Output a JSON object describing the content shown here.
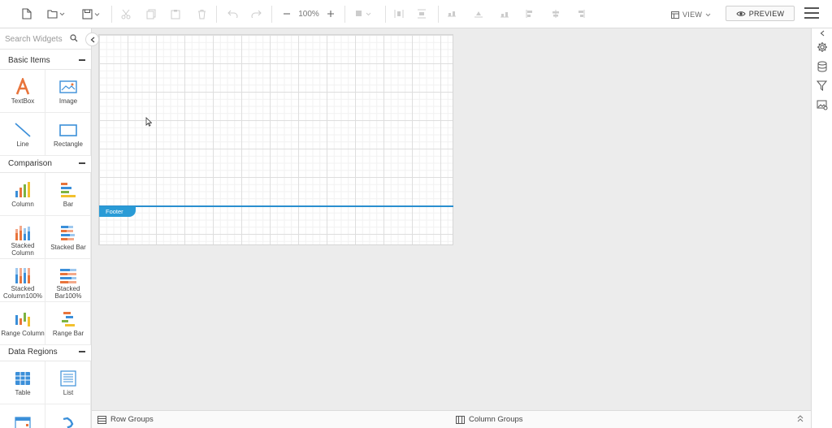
{
  "toolbar": {
    "zoom_level": "100%",
    "view_label": "VIEW",
    "preview_label": "PREVIEW"
  },
  "left_panel": {
    "search_placeholder": "Search Widgets",
    "categories": [
      {
        "label": "Basic Items",
        "items": [
          "TextBox",
          "Image",
          "Line",
          "Rectangle"
        ]
      },
      {
        "label": "Comparison",
        "items": [
          "Column",
          "Bar",
          "Stacked Column",
          "Stacked Bar",
          "Stacked Column100%",
          "Stacked Bar100%",
          "Range Column",
          "Range Bar"
        ]
      },
      {
        "label": "Data Regions",
        "items": [
          "Table",
          "List"
        ]
      }
    ]
  },
  "canvas": {
    "footer_label": "Footer"
  },
  "bottom_bar": {
    "row_groups": "Row Groups",
    "column_groups": "Column Groups"
  },
  "colors": {
    "accent": "#2a9bd6",
    "textbox_icon": "#e8743b",
    "chart_blue": "#3b8fd9",
    "chart_orange": "#e8743b",
    "chart_green": "#7cb342",
    "chart_yellow": "#f2c12e"
  }
}
